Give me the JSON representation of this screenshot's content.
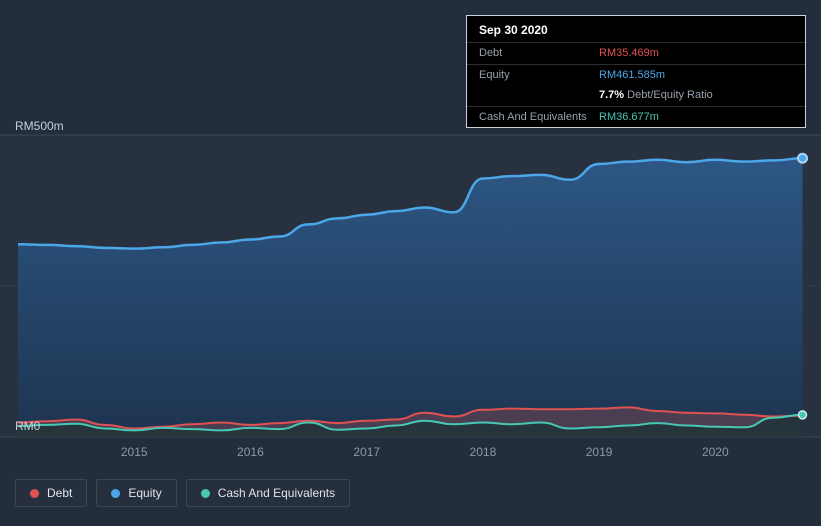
{
  "colors": {
    "background": "#232d3b",
    "debt": "#e05252",
    "equity": "#4ba7e8",
    "cash": "#47c8b5"
  },
  "tooltip": {
    "date": "Sep 30 2020",
    "debt_label": "Debt",
    "debt_value": "RM35.469m",
    "equity_label": "Equity",
    "equity_value": "RM461.585m",
    "ratio_percent": "7.7%",
    "ratio_label": "Debt/Equity Ratio",
    "cash_label": "Cash And Equivalents",
    "cash_value": "RM36.677m"
  },
  "legend": {
    "items": [
      {
        "label": "Debt",
        "color": "#e05252"
      },
      {
        "label": "Equity",
        "color": "#4ba7e8"
      },
      {
        "label": "Cash And Equivalents",
        "color": "#47c8b5"
      }
    ]
  },
  "chart_data": {
    "type": "area",
    "x_ticks": [
      2015,
      2016,
      2017,
      2018,
      2019,
      2020
    ],
    "x_range": [
      2014.0,
      2020.78
    ],
    "y_axis": {
      "min": 0,
      "max": 500,
      "top_label": "RM500m",
      "bottom_label": "RM0",
      "gridlines": [
        500,
        250,
        0
      ],
      "unit": "RM millions"
    },
    "legend_position": "bottom-left",
    "grid": true,
    "x": [
      2014.0,
      2014.25,
      2014.5,
      2014.75,
      2015.0,
      2015.25,
      2015.5,
      2015.75,
      2016.0,
      2016.25,
      2016.5,
      2016.75,
      2017.0,
      2017.25,
      2017.5,
      2017.75,
      2018.0,
      2018.25,
      2018.5,
      2018.75,
      2019.0,
      2019.25,
      2019.5,
      2019.75,
      2020.0,
      2020.25,
      2020.5,
      2020.75
    ],
    "series": [
      {
        "name": "Equity",
        "color": "#4ba7e8",
        "values": [
          319,
          318,
          316,
          313,
          312,
          314,
          318,
          322,
          327,
          332,
          352,
          362,
          368,
          374,
          380,
          372,
          428,
          432,
          434,
          426,
          452,
          456,
          459,
          455,
          459,
          456,
          458,
          461.585
        ]
      },
      {
        "name": "Debt",
        "color": "#e05252",
        "values": [
          24,
          26,
          29,
          20,
          14,
          17,
          21,
          24,
          20,
          23,
          27,
          23,
          27,
          29,
          40,
          34,
          45,
          47,
          46,
          46,
          47,
          49,
          43,
          40,
          39,
          37,
          34,
          35.469
        ]
      },
      {
        "name": "Cash And Equivalents",
        "color": "#47c8b5",
        "values": [
          18,
          20,
          22,
          14,
          11,
          15,
          13,
          11,
          15,
          13,
          24,
          12,
          14,
          19,
          27,
          21,
          24,
          21,
          24,
          14,
          16,
          19,
          23,
          19,
          17,
          16,
          32,
          36.677
        ]
      }
    ]
  }
}
